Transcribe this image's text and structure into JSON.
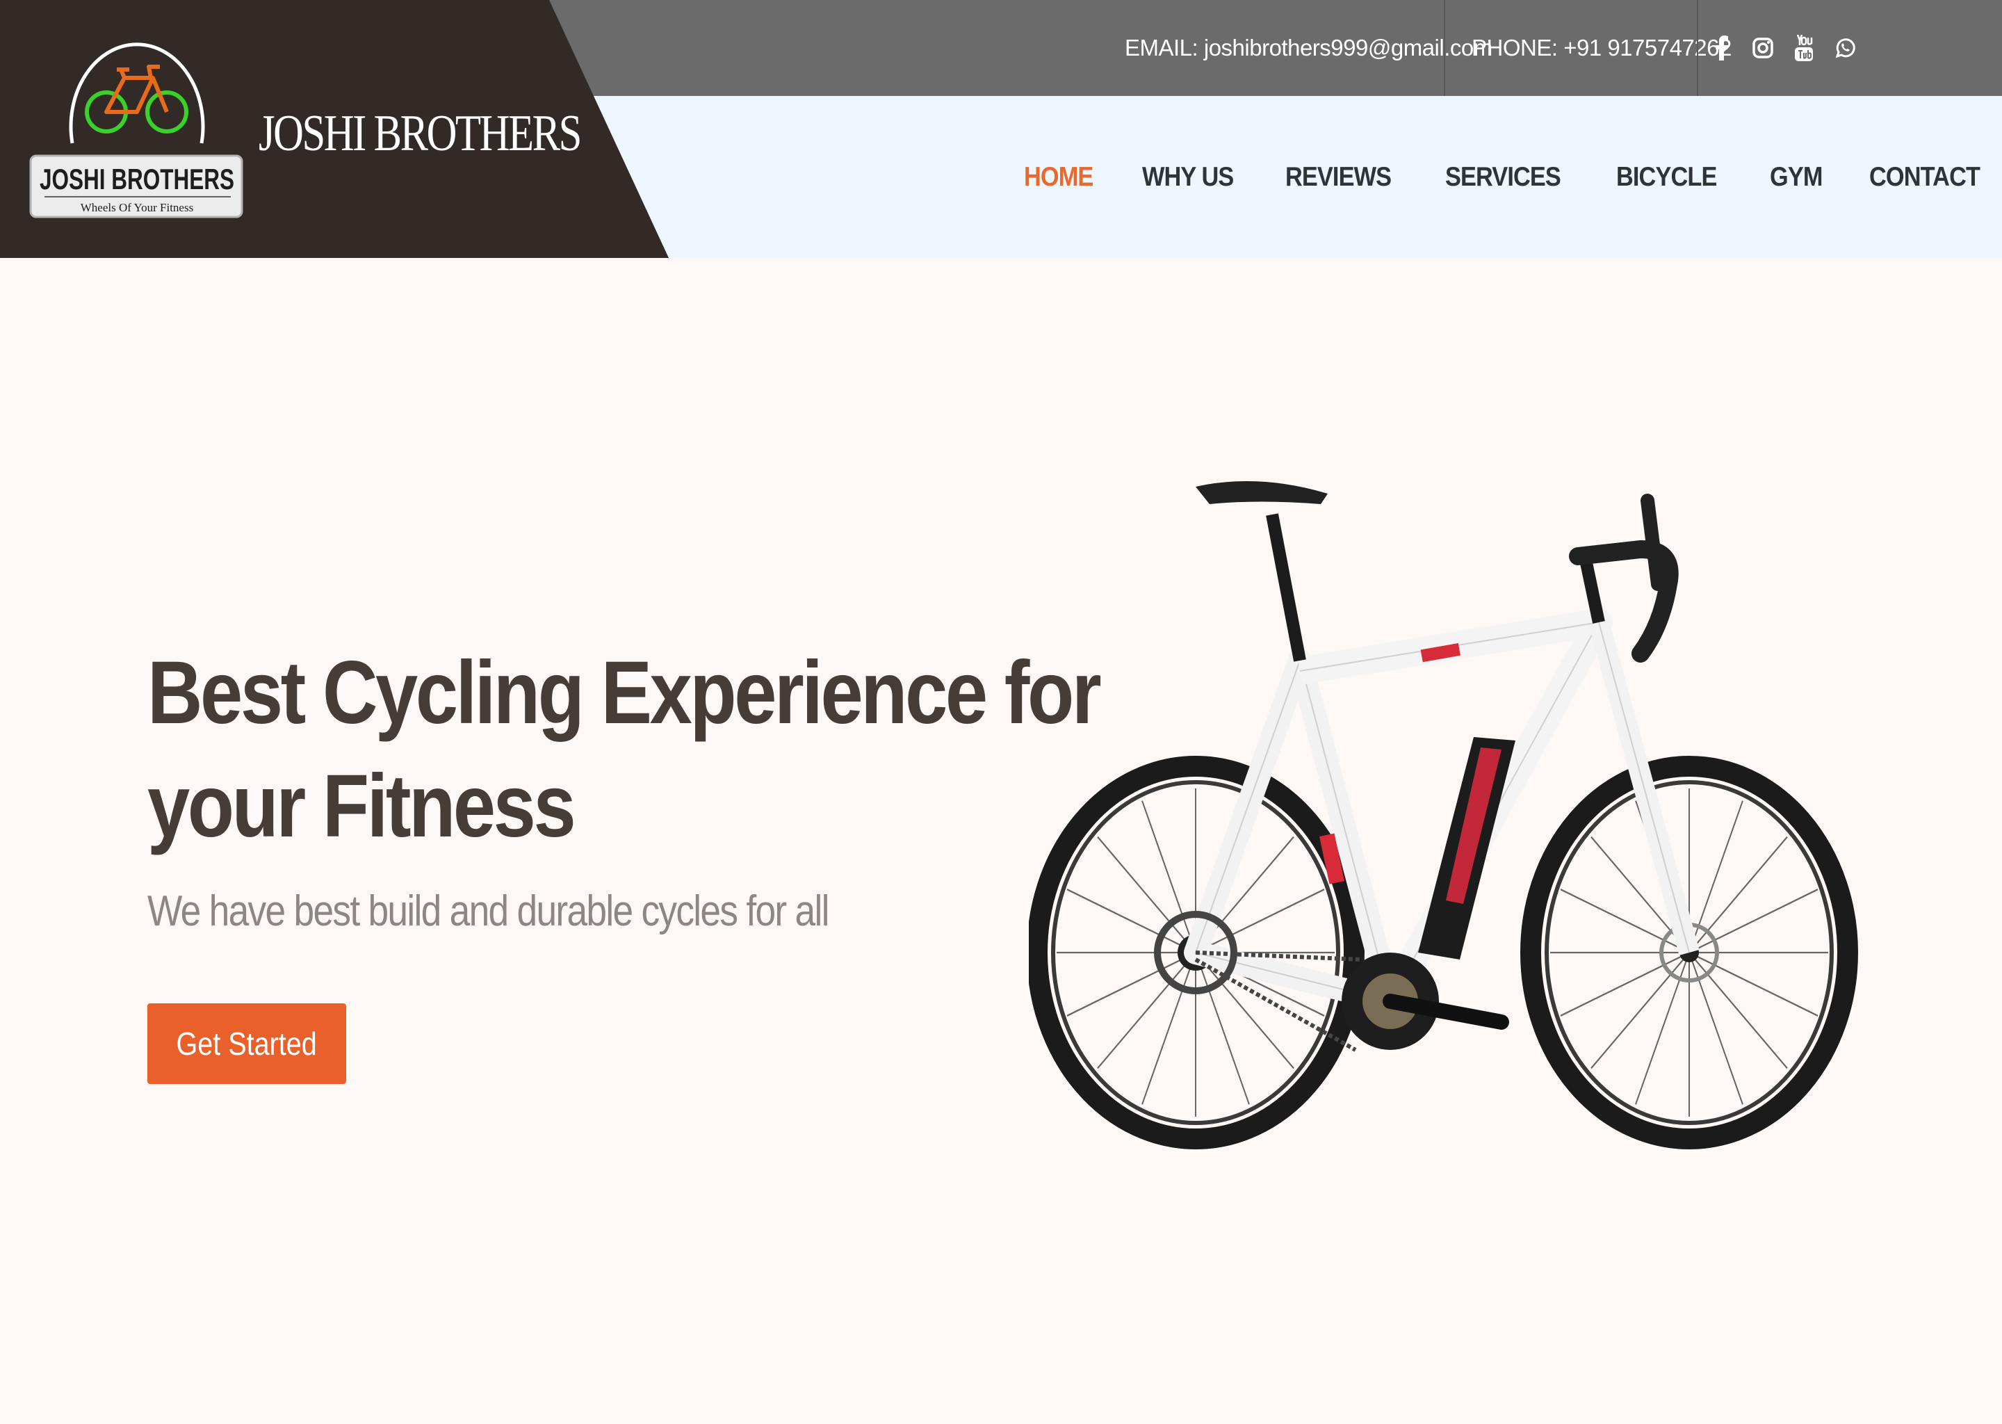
{
  "header": {
    "email_text": "EMAIL: joshibrothers999@gmail.com",
    "phone_text": "PHONE: +91 9175747262",
    "social_icons": [
      "facebook-icon",
      "instagram-icon",
      "youtube-icon",
      "whatsapp-icon"
    ]
  },
  "brand": {
    "name": "JOSHI BROTHERS",
    "badge_title": "JOSHI BROTHERS",
    "badge_tagline": "Wheels Of Your Fitness"
  },
  "nav": {
    "items": [
      {
        "label": "HOME",
        "active": true
      },
      {
        "label": "WHY US"
      },
      {
        "label": "REVIEWS"
      },
      {
        "label": "SERVICES"
      },
      {
        "label": "BICYCLE"
      },
      {
        "label": "GYM"
      },
      {
        "label": "CONTACT"
      }
    ]
  },
  "hero": {
    "title_line1": "Best Cycling Experience for",
    "title_line2": "your Fitness",
    "subtitle": "We have best build and durable cycles for all",
    "cta_label": "Get Started"
  },
  "colors": {
    "accent": "#e9692c",
    "dark_brand": "#322a27",
    "topbar": "#6b6b6b",
    "nav_bg": "#eef6ff",
    "hero_bg": "#fdf8f5",
    "title": "#463c38"
  }
}
